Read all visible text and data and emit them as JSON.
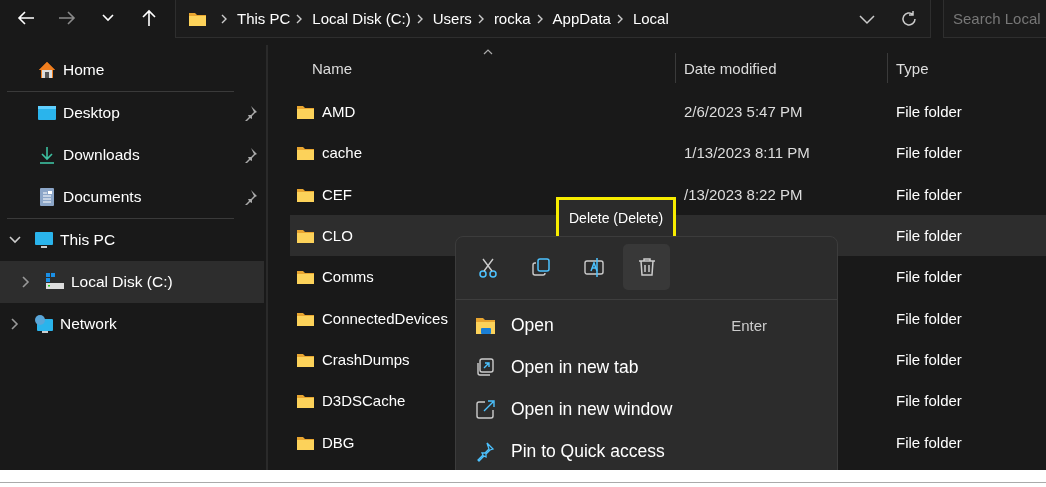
{
  "toolbar": {
    "buttons": [
      {
        "kind": "back",
        "disabled": false
      },
      {
        "kind": "forward",
        "disabled": true
      },
      {
        "kind": "recent",
        "disabled": false
      },
      {
        "kind": "up",
        "disabled": false
      }
    ]
  },
  "address_bar": {
    "breadcrumbs": [
      "This PC",
      "Local Disk (C:)",
      "Users",
      "rocka",
      "AppData",
      "Local"
    ]
  },
  "search": {
    "placeholder": "Search Local"
  },
  "sidebar": {
    "groups": [
      [
        {
          "label": "Home",
          "kind": "home",
          "pinned": false,
          "selected": false
        }
      ],
      [
        {
          "label": "Desktop",
          "kind": "desktop",
          "pinned": true,
          "selected": false
        },
        {
          "label": "Downloads",
          "kind": "download",
          "pinned": true,
          "selected": false
        },
        {
          "label": "Documents",
          "kind": "document",
          "pinned": true,
          "selected": false
        }
      ],
      [
        {
          "label": "This PC",
          "kind": "pc",
          "expanded": true,
          "selected": false,
          "children": [
            {
              "label": "Local Disk (C:)",
              "kind": "disk",
              "expanded": false,
              "selected": true
            }
          ]
        },
        {
          "label": "Network",
          "kind": "network",
          "expanded": false,
          "selected": false
        }
      ]
    ]
  },
  "file_list": {
    "columns": [
      {
        "label": "Name",
        "sorted": true
      },
      {
        "label": "Date modified",
        "sorted": false
      },
      {
        "label": "Type",
        "sorted": false
      }
    ],
    "rows": [
      {
        "name": "AMD",
        "date": "2/6/2023 5:47 PM",
        "type": "File folder",
        "selected": false
      },
      {
        "name": "cache",
        "date": "1/13/2023 8:11 PM",
        "type": "File folder",
        "selected": false
      },
      {
        "name": "CEF",
        "date": "/13/2023 8:22 PM",
        "type": "File folder",
        "selected": false
      },
      {
        "name": "CLO",
        "type": "File folder",
        "selected": true
      },
      {
        "name": "Comms",
        "type": "File folder",
        "selected": false
      },
      {
        "name": "ConnectedDevices",
        "type": "File folder",
        "selected": false
      },
      {
        "name": "CrashDumps",
        "type": "File folder",
        "selected": false
      },
      {
        "name": "D3DSCache",
        "type": "File folder",
        "selected": false
      },
      {
        "name": "DBG",
        "type": "File folder",
        "selected": false
      }
    ]
  },
  "context_menu": {
    "actions": [
      {
        "kind": "cut",
        "hovered": false
      },
      {
        "kind": "copy",
        "hovered": false
      },
      {
        "kind": "rename",
        "hovered": false
      },
      {
        "kind": "delete",
        "hovered": true
      }
    ],
    "items": [
      {
        "label": "Open",
        "kind": "folder",
        "shortcut": "Enter"
      },
      {
        "label": "Open in new tab",
        "kind": "tab"
      },
      {
        "label": "Open in new window",
        "kind": "window"
      },
      {
        "label": "Pin to Quick access",
        "kind": "pin"
      }
    ]
  },
  "tooltip": {
    "text": "Delete (Delete)",
    "highlighted": true
  }
}
